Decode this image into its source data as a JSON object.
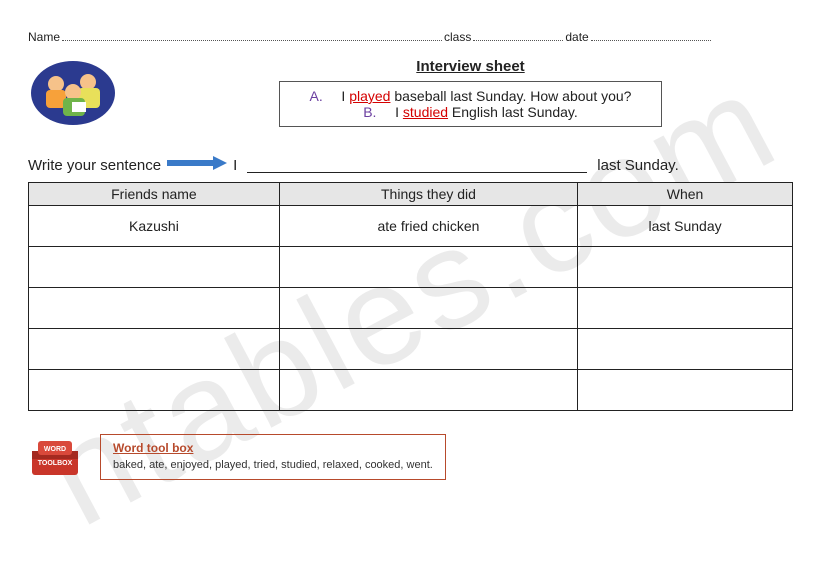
{
  "header": {
    "name_label": "Name",
    "class_label": "class",
    "date_label": "date"
  },
  "title": "Interview sheet",
  "example": {
    "a_label": "A.",
    "a_pre": "I ",
    "a_kw": "played",
    "a_post": " baseball last Sunday. How about you?",
    "b_label": "B.",
    "b_pre": "I ",
    "b_kw": "studied",
    "b_post": " English last Sunday."
  },
  "prompt": {
    "lead": "Write your sentence",
    "i": "I",
    "tail": "last Sunday."
  },
  "table": {
    "cols": [
      "Friends name",
      "Things they did",
      "When"
    ],
    "rows": [
      [
        "Kazushi",
        "ate fried chicken",
        "last Sunday"
      ],
      [
        "",
        "",
        ""
      ],
      [
        "",
        "",
        ""
      ],
      [
        "",
        "",
        ""
      ],
      [
        "",
        "",
        ""
      ]
    ]
  },
  "toolbox": {
    "title": "Word tool box",
    "words": "baked, ate, enjoyed, played, tried, studied, relaxed, cooked, went."
  },
  "watermark": "ntables.com",
  "chart_data": {
    "type": "table",
    "columns": [
      "Friends name",
      "Things they did",
      "When"
    ],
    "rows": [
      [
        "Kazushi",
        "ate fried chicken",
        "last Sunday"
      ]
    ]
  }
}
